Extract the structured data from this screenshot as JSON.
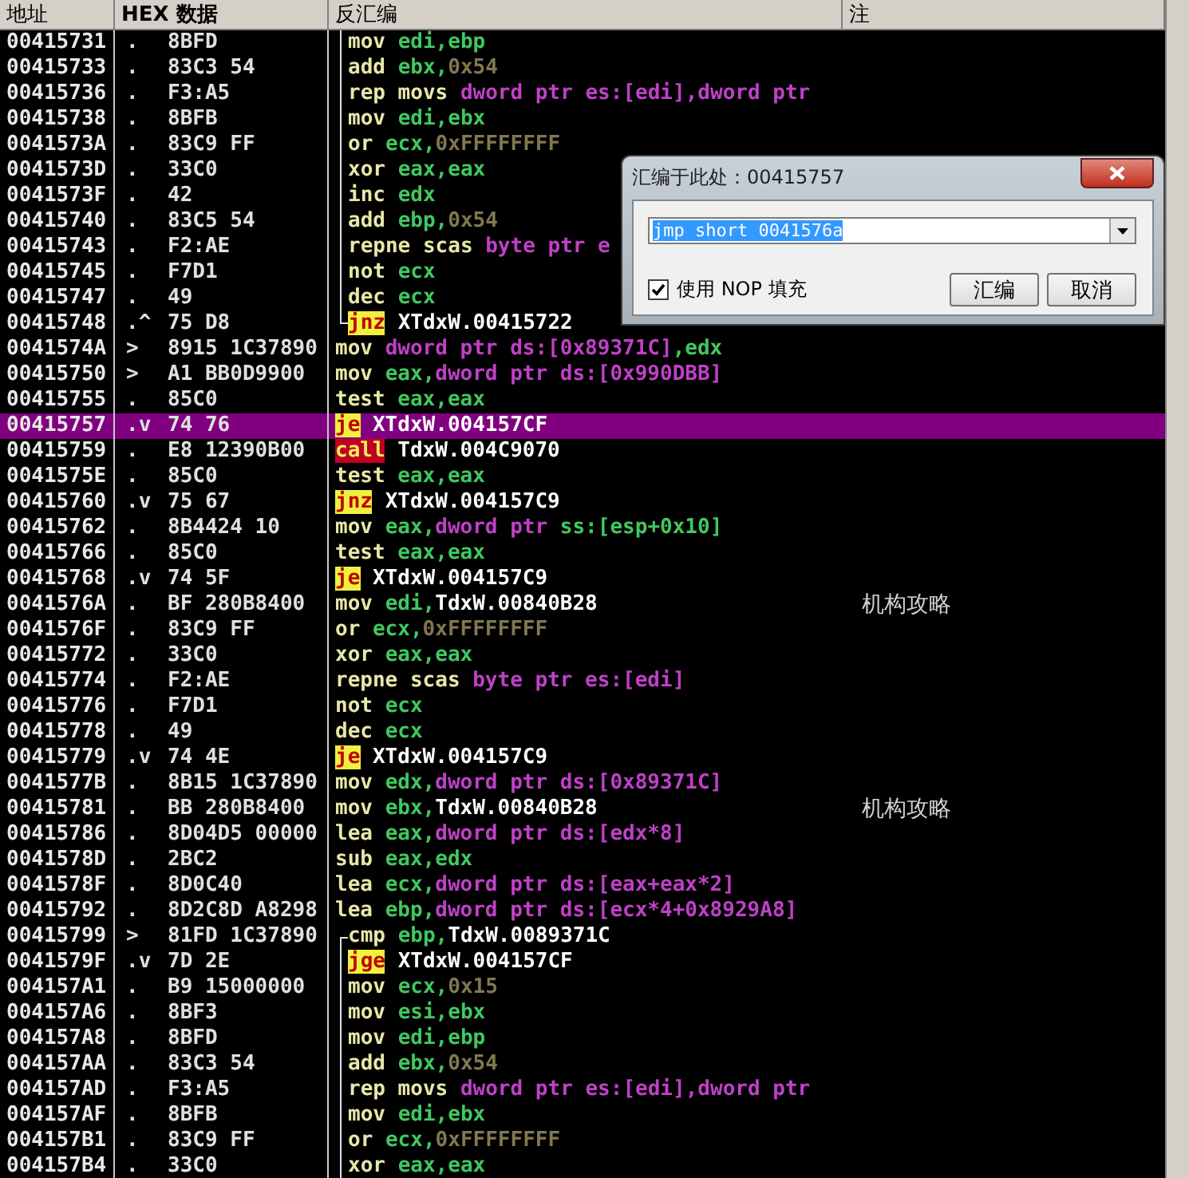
{
  "columns": [
    "地址",
    "HEX 数据",
    "反汇编",
    "注"
  ],
  "rows": [
    {
      "address": "00415731",
      "marker": ".",
      "hex": "8BFD",
      "mnemonic": {
        "text": "mov",
        "kind": "plain"
      },
      "operands": [
        {
          "kind": "reg",
          "text": "edi,ebp"
        }
      ],
      "bracket": {
        "kind": "mid"
      },
      "selected": false
    },
    {
      "address": "00415733",
      "marker": ".",
      "hex": "83C3 54",
      "mnemonic": {
        "text": "add",
        "kind": "plain"
      },
      "operands": [
        {
          "kind": "reg",
          "text": "ebx,"
        },
        {
          "kind": "const",
          "text": "0x54"
        }
      ],
      "bracket": {
        "kind": "mid"
      },
      "selected": false
    },
    {
      "address": "00415736",
      "marker": ".",
      "hex": "F3:A5",
      "mnemonic": {
        "text": "rep movs",
        "kind": "plain"
      },
      "operands": [
        {
          "kind": "mem",
          "text": "dword ptr es:[edi],dword ptr"
        }
      ],
      "bracket": {
        "kind": "mid"
      },
      "selected": false
    },
    {
      "address": "00415738",
      "marker": ".",
      "hex": "8BFB",
      "mnemonic": {
        "text": "mov",
        "kind": "plain"
      },
      "operands": [
        {
          "kind": "reg",
          "text": "edi,ebx"
        }
      ],
      "bracket": {
        "kind": "mid"
      },
      "selected": false
    },
    {
      "address": "0041573A",
      "marker": ".",
      "hex": "83C9 FF",
      "mnemonic": {
        "text": "or",
        "kind": "plain"
      },
      "operands": [
        {
          "kind": "reg",
          "text": "ecx,"
        },
        {
          "kind": "const",
          "text": "0xFFFFFFFF"
        }
      ],
      "bracket": {
        "kind": "mid"
      },
      "selected": false
    },
    {
      "address": "0041573D",
      "marker": ".",
      "hex": "33C0",
      "mnemonic": {
        "text": "xor",
        "kind": "plain"
      },
      "operands": [
        {
          "kind": "reg",
          "text": "eax,eax"
        }
      ],
      "bracket": {
        "kind": "mid"
      },
      "selected": false
    },
    {
      "address": "0041573F",
      "marker": ".",
      "hex": "42",
      "mnemonic": {
        "text": "inc",
        "kind": "plain"
      },
      "operands": [
        {
          "kind": "reg",
          "text": "edx"
        }
      ],
      "bracket": {
        "kind": "mid"
      },
      "selected": false
    },
    {
      "address": "00415740",
      "marker": ".",
      "hex": "83C5 54",
      "mnemonic": {
        "text": "add",
        "kind": "plain"
      },
      "operands": [
        {
          "kind": "reg",
          "text": "ebp,"
        },
        {
          "kind": "const",
          "text": "0x54"
        }
      ],
      "bracket": {
        "kind": "mid"
      },
      "selected": false
    },
    {
      "address": "00415743",
      "marker": ".",
      "hex": "F2:AE",
      "mnemonic": {
        "text": "repne scas",
        "kind": "plain"
      },
      "operands": [
        {
          "kind": "mem",
          "text": "byte ptr e"
        }
      ],
      "bracket": {
        "kind": "mid"
      },
      "selected": false
    },
    {
      "address": "00415745",
      "marker": ".",
      "hex": "F7D1",
      "mnemonic": {
        "text": "not",
        "kind": "plain"
      },
      "operands": [
        {
          "kind": "reg",
          "text": "ecx"
        }
      ],
      "bracket": {
        "kind": "mid"
      },
      "selected": false
    },
    {
      "address": "00415747",
      "marker": ".",
      "hex": "49",
      "mnemonic": {
        "text": "dec",
        "kind": "plain"
      },
      "operands": [
        {
          "kind": "reg",
          "text": "ecx"
        }
      ],
      "bracket": {
        "kind": "mid"
      },
      "selected": false
    },
    {
      "address": "00415748",
      "marker": ".^",
      "hex": "75 D8",
      "mnemonic": {
        "text": "jnz",
        "kind": "jump"
      },
      "operands": [
        {
          "kind": "name",
          "text": "XTdxW.00415722"
        }
      ],
      "bracket": {
        "kind": "end"
      },
      "selected": false
    },
    {
      "address": "0041574A",
      "marker": ">",
      "hex": "8915 1C37890",
      "mnemonic": {
        "text": "mov",
        "kind": "plain"
      },
      "operands": [
        {
          "kind": "mem",
          "text": "dword ptr ds:[0x89371C]"
        },
        {
          "kind": "reg",
          "text": ",edx"
        }
      ],
      "selected": false
    },
    {
      "address": "00415750",
      "marker": ">",
      "hex": "A1 BB0D9900",
      "mnemonic": {
        "text": "mov",
        "kind": "plain"
      },
      "operands": [
        {
          "kind": "reg",
          "text": "eax,"
        },
        {
          "kind": "mem",
          "text": "dword ptr ds:[0x990DBB]"
        }
      ],
      "selected": false
    },
    {
      "address": "00415755",
      "marker": ".",
      "hex": "85C0",
      "mnemonic": {
        "text": "test",
        "kind": "plain"
      },
      "operands": [
        {
          "kind": "reg",
          "text": "eax,eax"
        }
      ],
      "selected": false
    },
    {
      "address": "00415757",
      "marker": ".v",
      "hex": "74 76",
      "mnemonic": {
        "text": "je",
        "kind": "jump"
      },
      "operands": [
        {
          "kind": "name",
          "text": "XTdxW.004157CF"
        }
      ],
      "selected": true
    },
    {
      "address": "00415759",
      "marker": ".",
      "hex": "E8 12390B00",
      "mnemonic": {
        "text": "call",
        "kind": "call"
      },
      "operands": [
        {
          "kind": "name",
          "text": "TdxW.004C9070"
        }
      ],
      "selected": false
    },
    {
      "address": "0041575E",
      "marker": ".",
      "hex": "85C0",
      "mnemonic": {
        "text": "test",
        "kind": "plain"
      },
      "operands": [
        {
          "kind": "reg",
          "text": "eax,eax"
        }
      ],
      "selected": false
    },
    {
      "address": "00415760",
      "marker": ".v",
      "hex": "75 67",
      "mnemonic": {
        "text": "jnz",
        "kind": "jump"
      },
      "operands": [
        {
          "kind": "name",
          "text": "XTdxW.004157C9"
        }
      ],
      "selected": false
    },
    {
      "address": "00415762",
      "marker": ".",
      "hex": "8B4424 10",
      "mnemonic": {
        "text": "mov",
        "kind": "plain"
      },
      "operands": [
        {
          "kind": "reg",
          "text": "eax,"
        },
        {
          "kind": "mem",
          "text": "dword ptr "
        },
        {
          "kind": "reg",
          "text": "ss:[esp+0x10]"
        }
      ],
      "selected": false
    },
    {
      "address": "00415766",
      "marker": ".",
      "hex": "85C0",
      "mnemonic": {
        "text": "test",
        "kind": "plain"
      },
      "operands": [
        {
          "kind": "reg",
          "text": "eax,eax"
        }
      ],
      "selected": false
    },
    {
      "address": "00415768",
      "marker": ".v",
      "hex": "74 5F",
      "mnemonic": {
        "text": "je",
        "kind": "jump"
      },
      "operands": [
        {
          "kind": "name",
          "text": "XTdxW.004157C9"
        }
      ],
      "selected": false
    },
    {
      "address": "0041576A",
      "marker": ".",
      "hex": "BF 280B8400",
      "mnemonic": {
        "text": "mov",
        "kind": "plain"
      },
      "operands": [
        {
          "kind": "reg",
          "text": "edi,"
        },
        {
          "kind": "name",
          "text": "TdxW.00840B28"
        }
      ],
      "comment": "机构攻略",
      "selected": false
    },
    {
      "address": "0041576F",
      "marker": ".",
      "hex": "83C9 FF",
      "mnemonic": {
        "text": "or",
        "kind": "plain"
      },
      "operands": [
        {
          "kind": "reg",
          "text": "ecx,"
        },
        {
          "kind": "const",
          "text": "0xFFFFFFFF"
        }
      ],
      "selected": false
    },
    {
      "address": "00415772",
      "marker": ".",
      "hex": "33C0",
      "mnemonic": {
        "text": "xor",
        "kind": "plain"
      },
      "operands": [
        {
          "kind": "reg",
          "text": "eax,eax"
        }
      ],
      "selected": false
    },
    {
      "address": "00415774",
      "marker": ".",
      "hex": "F2:AE",
      "mnemonic": {
        "text": "repne scas",
        "kind": "plain"
      },
      "operands": [
        {
          "kind": "mem",
          "text": "byte ptr es:[edi]"
        }
      ],
      "selected": false
    },
    {
      "address": "00415776",
      "marker": ".",
      "hex": "F7D1",
      "mnemonic": {
        "text": "not",
        "kind": "plain"
      },
      "operands": [
        {
          "kind": "reg",
          "text": "ecx"
        }
      ],
      "selected": false
    },
    {
      "address": "00415778",
      "marker": ".",
      "hex": "49",
      "mnemonic": {
        "text": "dec",
        "kind": "plain"
      },
      "operands": [
        {
          "kind": "reg",
          "text": "ecx"
        }
      ],
      "selected": false
    },
    {
      "address": "00415779",
      "marker": ".v",
      "hex": "74 4E",
      "mnemonic": {
        "text": "je",
        "kind": "jump"
      },
      "operands": [
        {
          "kind": "name",
          "text": "XTdxW.004157C9"
        }
      ],
      "selected": false
    },
    {
      "address": "0041577B",
      "marker": ".",
      "hex": "8B15 1C37890",
      "mnemonic": {
        "text": "mov",
        "kind": "plain"
      },
      "operands": [
        {
          "kind": "reg",
          "text": "edx,"
        },
        {
          "kind": "mem",
          "text": "dword ptr ds:[0x89371C]"
        }
      ],
      "selected": false
    },
    {
      "address": "00415781",
      "marker": ".",
      "hex": "BB 280B8400",
      "mnemonic": {
        "text": "mov",
        "kind": "plain"
      },
      "operands": [
        {
          "kind": "reg",
          "text": "ebx,"
        },
        {
          "kind": "name",
          "text": "TdxW.00840B28"
        }
      ],
      "comment": "机构攻略",
      "selected": false
    },
    {
      "address": "00415786",
      "marker": ".",
      "hex": "8D04D5 00000",
      "mnemonic": {
        "text": "lea",
        "kind": "plain"
      },
      "operands": [
        {
          "kind": "reg",
          "text": "eax,"
        },
        {
          "kind": "mem",
          "text": "dword ptr ds:[edx*8]"
        }
      ],
      "selected": false
    },
    {
      "address": "0041578D",
      "marker": ".",
      "hex": "2BC2",
      "mnemonic": {
        "text": "sub",
        "kind": "plain"
      },
      "operands": [
        {
          "kind": "reg",
          "text": "eax,edx"
        }
      ],
      "selected": false
    },
    {
      "address": "0041578F",
      "marker": ".",
      "hex": "8D0C40",
      "mnemonic": {
        "text": "lea",
        "kind": "plain"
      },
      "operands": [
        {
          "kind": "reg",
          "text": "ecx,"
        },
        {
          "kind": "mem",
          "text": "dword ptr ds:[eax+eax*2]"
        }
      ],
      "selected": false
    },
    {
      "address": "00415792",
      "marker": ".",
      "hex": "8D2C8D A8298",
      "mnemonic": {
        "text": "lea",
        "kind": "plain"
      },
      "operands": [
        {
          "kind": "reg",
          "text": "ebp,"
        },
        {
          "kind": "mem",
          "text": "dword ptr ds:[ecx*4+0x8929A8]"
        }
      ],
      "selected": false
    },
    {
      "address": "00415799",
      "marker": ">",
      "hex": "81FD 1C37890",
      "mnemonic": {
        "text": "cmp",
        "kind": "plain"
      },
      "operands": [
        {
          "kind": "reg",
          "text": "ebp,"
        },
        {
          "kind": "name",
          "text": "TdxW.0089371C"
        }
      ],
      "bracket": {
        "kind": "start"
      },
      "selected": false
    },
    {
      "address": "0041579F",
      "marker": ".v",
      "hex": "7D 2E",
      "mnemonic": {
        "text": "jge",
        "kind": "jump"
      },
      "operands": [
        {
          "kind": "name",
          "text": "XTdxW.004157CF"
        }
      ],
      "bracket": {
        "kind": "mid"
      },
      "selected": false
    },
    {
      "address": "004157A1",
      "marker": ".",
      "hex": "B9 15000000",
      "mnemonic": {
        "text": "mov",
        "kind": "plain"
      },
      "operands": [
        {
          "kind": "reg",
          "text": "ecx,"
        },
        {
          "kind": "const",
          "text": "0x15"
        }
      ],
      "bracket": {
        "kind": "mid"
      },
      "selected": false
    },
    {
      "address": "004157A6",
      "marker": ".",
      "hex": "8BF3",
      "mnemonic": {
        "text": "mov",
        "kind": "plain"
      },
      "operands": [
        {
          "kind": "reg",
          "text": "esi,ebx"
        }
      ],
      "bracket": {
        "kind": "mid"
      },
      "selected": false
    },
    {
      "address": "004157A8",
      "marker": ".",
      "hex": "8BFD",
      "mnemonic": {
        "text": "mov",
        "kind": "plain"
      },
      "operands": [
        {
          "kind": "reg",
          "text": "edi,ebp"
        }
      ],
      "bracket": {
        "kind": "mid"
      },
      "selected": false
    },
    {
      "address": "004157AA",
      "marker": ".",
      "hex": "83C3 54",
      "mnemonic": {
        "text": "add",
        "kind": "plain"
      },
      "operands": [
        {
          "kind": "reg",
          "text": "ebx,"
        },
        {
          "kind": "const",
          "text": "0x54"
        }
      ],
      "bracket": {
        "kind": "mid"
      },
      "selected": false
    },
    {
      "address": "004157AD",
      "marker": ".",
      "hex": "F3:A5",
      "mnemonic": {
        "text": "rep movs",
        "kind": "plain"
      },
      "operands": [
        {
          "kind": "mem",
          "text": "dword ptr es:[edi],dword ptr"
        }
      ],
      "bracket": {
        "kind": "mid"
      },
      "selected": false
    },
    {
      "address": "004157AF",
      "marker": ".",
      "hex": "8BFB",
      "mnemonic": {
        "text": "mov",
        "kind": "plain"
      },
      "operands": [
        {
          "kind": "reg",
          "text": "edi,ebx"
        }
      ],
      "bracket": {
        "kind": "mid"
      },
      "selected": false
    },
    {
      "address": "004157B1",
      "marker": ".",
      "hex": "83C9 FF",
      "mnemonic": {
        "text": "or",
        "kind": "plain"
      },
      "operands": [
        {
          "kind": "reg",
          "text": "ecx,"
        },
        {
          "kind": "const",
          "text": "0xFFFFFFFF"
        }
      ],
      "bracket": {
        "kind": "mid"
      },
      "selected": false
    },
    {
      "address": "004157B4",
      "marker": ".",
      "hex": "33C0",
      "mnemonic": {
        "text": "xor",
        "kind": "plain"
      },
      "operands": [
        {
          "kind": "reg",
          "text": "eax,eax"
        }
      ],
      "bracket": {
        "kind": "mid"
      },
      "selected": false
    }
  ],
  "dialog": {
    "title": "汇编于此处：00415757",
    "input": {
      "value": "jmp short 0041576a",
      "text_selected": true
    },
    "nop_fill": {
      "label": "使用 NOP 填充",
      "checked": true
    },
    "buttons": [
      "汇编",
      "取消"
    ]
  }
}
